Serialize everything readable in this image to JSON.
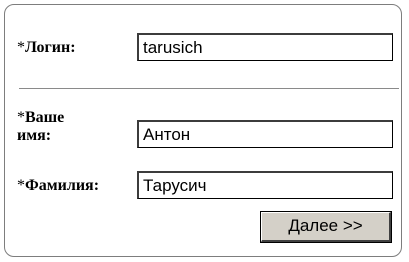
{
  "form": {
    "login": {
      "required_mark": "*",
      "label": "Логин:",
      "value": "tarusich"
    },
    "first_name": {
      "required_mark": "*",
      "label_line1": "Ваше",
      "label_line2": "имя:",
      "value": "Антон"
    },
    "last_name": {
      "required_mark": "*",
      "label": "Фамилия:",
      "value": "Тарусич"
    },
    "next_button_label": "Далее >>"
  }
}
